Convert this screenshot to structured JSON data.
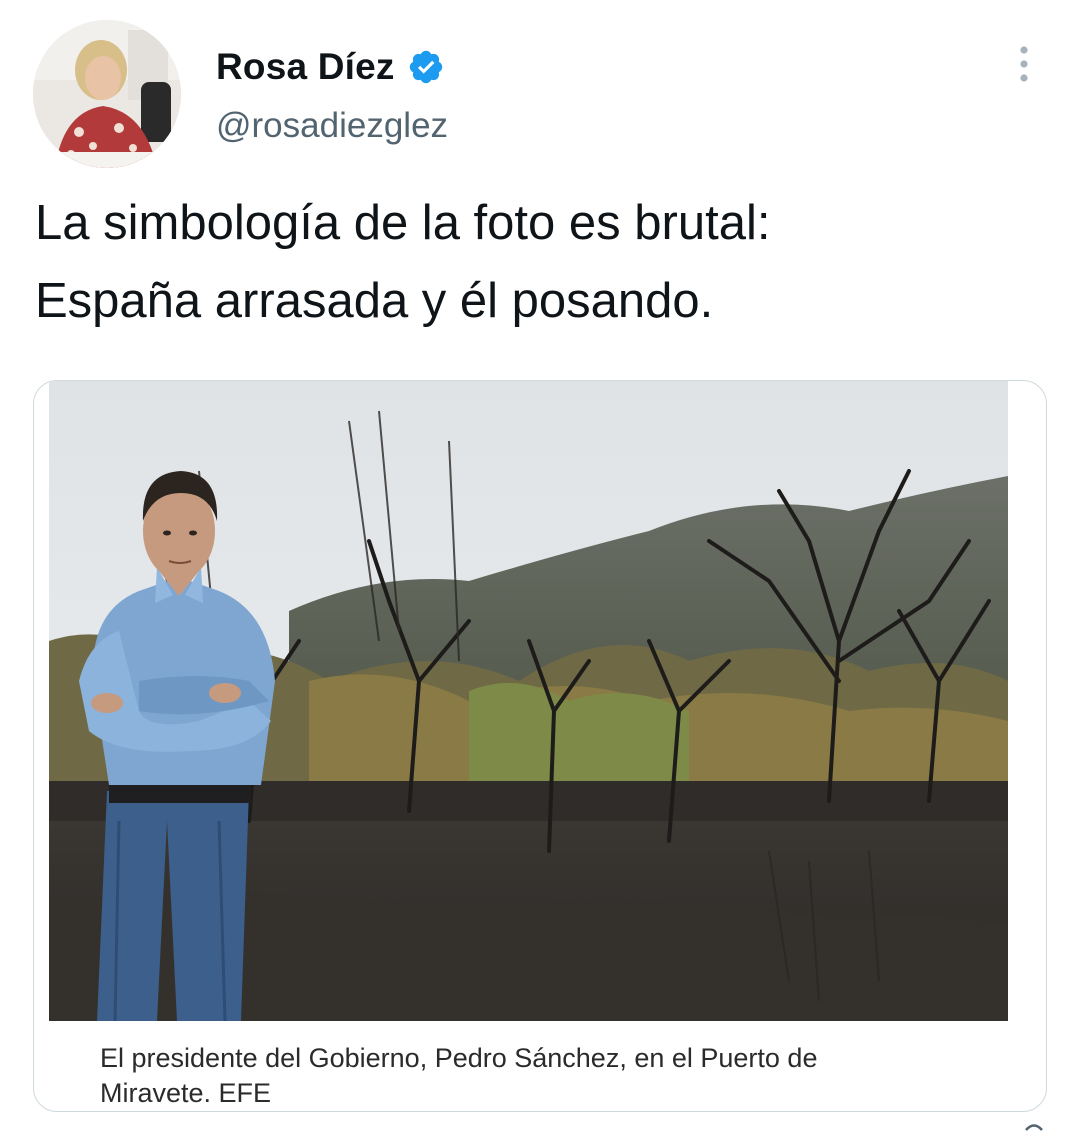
{
  "author": {
    "display_name": "Rosa Díez",
    "handle": "@rosadiezglez",
    "verified": true,
    "avatar_icon": "profile-photo"
  },
  "tweet": {
    "text_lines": [
      "La simbología de la foto es brutal:",
      "España arrasada y él posando."
    ]
  },
  "media": {
    "photo_icon": "photo-man-in-burned-forest",
    "caption_lines": [
      "El presidente del Gobierno, Pedro Sánchez, en el Puerto de",
      "Miravete. EFE"
    ]
  },
  "icons": {
    "more": "more-vertical-icon",
    "verified": "verified-badge-icon"
  },
  "colors": {
    "text_primary": "#0f1419",
    "text_secondary": "#536471",
    "verified_blue": "#1d9bf0",
    "card_border": "#cfd9de"
  }
}
